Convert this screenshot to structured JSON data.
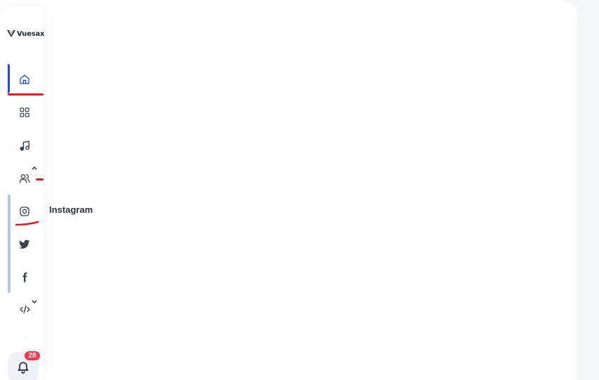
{
  "brand": {
    "logo_text": "Vuesax",
    "logo_icon": "vuesax-logo"
  },
  "sidebar": {
    "items": [
      {
        "id": "home",
        "icon": "home-icon",
        "active": true
      },
      {
        "id": "apps",
        "icon": "grid-icon"
      },
      {
        "id": "music",
        "icon": "music-icon"
      },
      {
        "id": "users",
        "icon": "users-icon",
        "caret": "up"
      },
      {
        "id": "instagram",
        "icon": "instagram-icon",
        "hovered": true
      },
      {
        "id": "twitter",
        "icon": "twitter-icon"
      },
      {
        "id": "facebook",
        "icon": "facebook-icon"
      },
      {
        "id": "code",
        "icon": "code-icon",
        "caret": "down"
      }
    ]
  },
  "tooltip": {
    "label": "Instagram"
  },
  "notifications": {
    "icon": "bell-icon",
    "count": "28"
  },
  "colors": {
    "accent": "#1f46ef",
    "group_bar": "#b6c2f6",
    "badge": "#f0394f",
    "annotation_red": "#e11d2a",
    "icon": "#3a4150"
  }
}
